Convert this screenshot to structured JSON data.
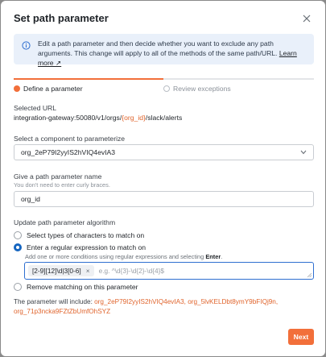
{
  "dialog": {
    "title": "Set path parameter",
    "info_text": "Edit a path parameter and then decide whether you want to exclude any path arguments. This change will apply to all of the methods of the same path/URL.",
    "learn_more": "Learn more ↗"
  },
  "steps": [
    {
      "label": "Define a parameter",
      "active": true
    },
    {
      "label": "Review exceptions",
      "active": false
    }
  ],
  "selected_url": {
    "label": "Selected URL",
    "prefix": "integration-gateway:50080/v1/orgs/",
    "param": "{org_id}",
    "suffix": "/slack/alerts"
  },
  "component": {
    "label": "Select a component to parameterize",
    "value": "org_2eP79I2yyIS2hVIQ4evIA3"
  },
  "param_name": {
    "label": "Give a path parameter name",
    "hint": "You don't need to enter curly braces.",
    "value": "org_id"
  },
  "algorithm": {
    "label": "Update path parameter algorithm",
    "options": [
      {
        "label": "Select types of characters to match on",
        "checked": false
      },
      {
        "label": "Enter a regular expression to match on",
        "checked": true
      },
      {
        "label": "Remove matching on this parameter",
        "checked": false
      }
    ],
    "regex_hint_prefix": "Add one or more conditions using regular expressions and selecting ",
    "regex_hint_key": "Enter",
    "regex_hint_suffix": ".",
    "regex_chip": "[2-9][12]\\d|3[0-6]",
    "regex_placeholder": "e.g. ^\\d{3}-\\d{2}-\\d{4}$"
  },
  "include": {
    "prefix": "The parameter will include: ",
    "ids": "org_2eP79I2yyIS2hVIQ4evIA3, org_5lvKELDbt8ymY9bFIQj9n, org_71p3ncka9FZtZbUmfOhSYZ"
  },
  "footer": {
    "next_label": "Next"
  },
  "colors": {
    "accent": "#f26f3a",
    "link_blue": "#2f6fd0",
    "info_bg": "#e9f0fa"
  }
}
